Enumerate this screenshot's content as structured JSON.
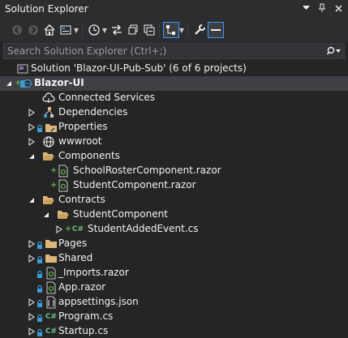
{
  "window": {
    "title": "Solution Explorer",
    "pin_glyph": "▾",
    "pushpin_glyph": "⊣",
    "close_glyph": "×"
  },
  "search": {
    "placeholder": "Search Solution Explorer (Ctrl+;)"
  },
  "tree": [
    {
      "id": "solution",
      "label": "Solution 'Blazor-UI-Pub-Sub' (6 of 6 projects)",
      "icon": "solution-icon"
    },
    {
      "id": "project",
      "label": "Blazor-UI",
      "icon": "web-project-icon",
      "bold": true
    },
    {
      "id": "connected",
      "label": "Connected Services",
      "icon": "cloud-icon"
    },
    {
      "id": "deps",
      "label": "Dependencies",
      "icon": "dependencies-icon"
    },
    {
      "id": "props",
      "label": "Properties",
      "icon": "wrench-folder-icon"
    },
    {
      "id": "wwwroot",
      "label": "wwwroot",
      "icon": "globe-icon"
    },
    {
      "id": "components",
      "label": "Components",
      "icon": "folder-open-icon"
    },
    {
      "id": "schoolroster",
      "label": "SchoolRosterComponent.razor",
      "icon": "razor-file-icon"
    },
    {
      "id": "studentcomp",
      "label": "StudentComponent.razor",
      "icon": "razor-file-icon"
    },
    {
      "id": "contracts",
      "label": "Contracts",
      "icon": "folder-open-icon"
    },
    {
      "id": "studentcompfolder",
      "label": "StudentComponent",
      "icon": "folder-open-icon"
    },
    {
      "id": "studentadded",
      "label": "StudentAddedEvent.cs",
      "icon": "csharp-file-icon",
      "prefix": "C#"
    },
    {
      "id": "pages",
      "label": "Pages",
      "icon": "folder-icon"
    },
    {
      "id": "shared",
      "label": "Shared",
      "icon": "folder-icon"
    },
    {
      "id": "imports",
      "label": "_Imports.razor",
      "icon": "razor-file-icon"
    },
    {
      "id": "app",
      "label": "App.razor",
      "icon": "razor-file-icon"
    },
    {
      "id": "appsettings",
      "label": "appsettings.json",
      "icon": "json-file-icon"
    },
    {
      "id": "program",
      "label": "Program.cs",
      "icon": "csharp-file-icon",
      "prefix": "C#"
    },
    {
      "id": "startup",
      "label": "Startup.cs",
      "icon": "csharp-file-icon",
      "prefix": "C#"
    }
  ],
  "colors": {
    "background": "#252526",
    "toolbar": "#2d2d30",
    "selection_outline": "#3399ff",
    "folder": "#dcb67a",
    "added_plus": "#61b04a",
    "lock": "#3c9bd6",
    "csharp": "#68c07b"
  }
}
